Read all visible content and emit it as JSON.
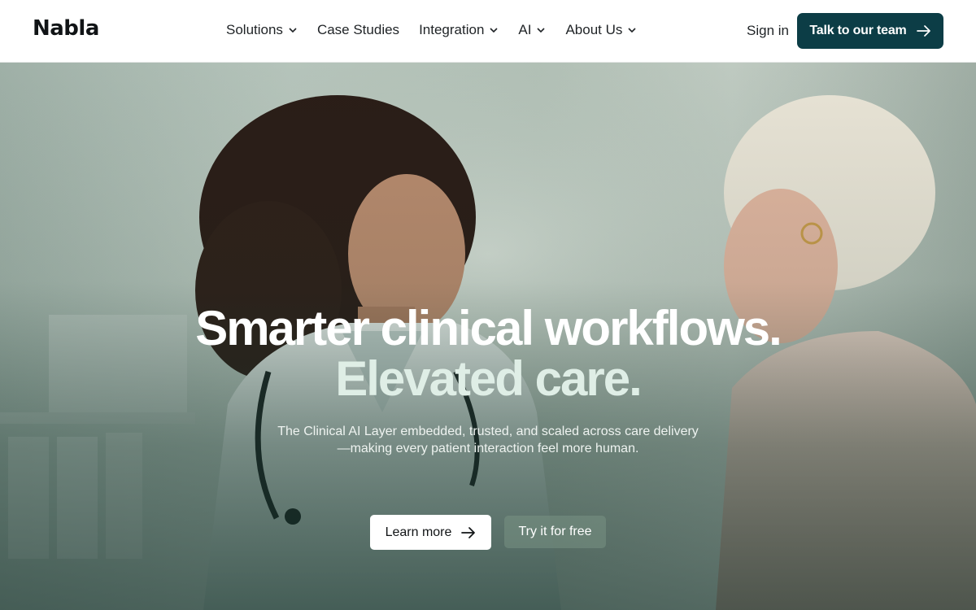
{
  "brand": {
    "logo_text": "Nabla"
  },
  "nav": {
    "items": [
      {
        "label": "Solutions",
        "has_dropdown": true
      },
      {
        "label": "Case Studies",
        "has_dropdown": false
      },
      {
        "label": "Integration",
        "has_dropdown": true
      },
      {
        "label": "AI",
        "has_dropdown": true
      },
      {
        "label": "About Us",
        "has_dropdown": true
      }
    ],
    "sign_in": "Sign in",
    "cta": "Talk to our team"
  },
  "hero": {
    "headline_line1": "Smarter clinical workflows.",
    "headline_line2": "Elevated care.",
    "subcopy_line1": "The Clinical AI Layer embedded, trusted, and scaled across care delivery",
    "subcopy_line2": "—making every patient interaction feel more human.",
    "primary_button": "Learn more",
    "secondary_button": "Try it for free"
  },
  "colors": {
    "brand_dark_teal": "#0c3d46",
    "text_dark": "#1b1d1f",
    "white": "#ffffff"
  },
  "icons": {
    "dropdown": "chevron-down-icon",
    "arrow": "arrow-right-icon"
  }
}
